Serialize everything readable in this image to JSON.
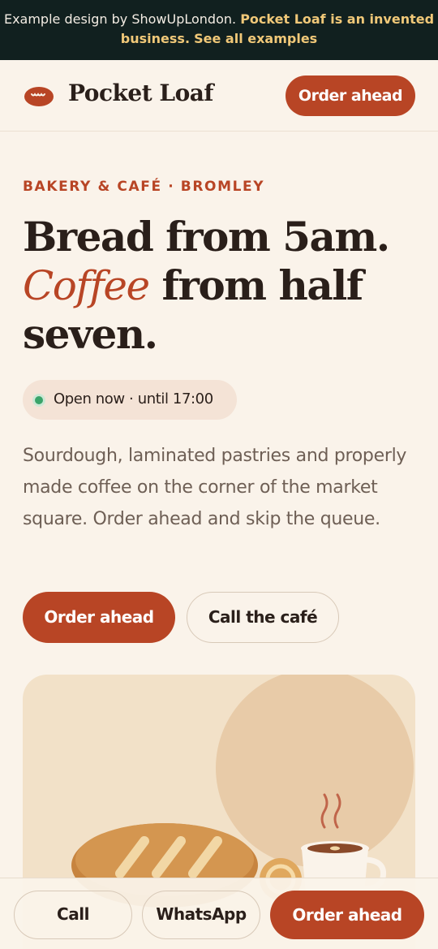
{
  "banner": {
    "prefix": "Example design by ShowUpLondon.",
    "highlight": "Pocket Loaf is an invented business.",
    "link": "See all examples"
  },
  "header": {
    "brand": "Pocket Loaf",
    "order_button": "Order ahead"
  },
  "hero": {
    "eyebrow": "BAKERY & CAFÉ · BROMLEY",
    "headline_part1": "Bread from 5am.",
    "headline_accent": "Coffee",
    "headline_part2": "from half seven.",
    "status": "Open now · until 17:00",
    "lead": "Sourdough, laminated pastries and properly made coffee on the corner of the market square. Order ahead and skip the queue.",
    "primary_button": "Order ahead",
    "secondary_button": "Call the café"
  },
  "bottom_bar": {
    "call": "Call",
    "whatsapp": "WhatsApp",
    "order": "Order ahead"
  },
  "colors": {
    "accent": "#b84525",
    "banner_bg": "#11201f",
    "banner_highlight": "#f0c878",
    "page_bg": "#faf3ea",
    "status_green": "#3aa46a"
  },
  "icons": {
    "logo": "bread-loaf-icon",
    "illustration": "bread-and-coffee-illustration"
  }
}
